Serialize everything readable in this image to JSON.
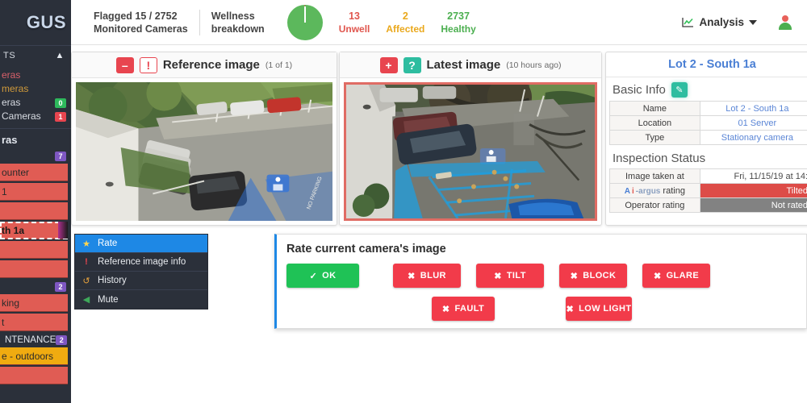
{
  "brand": {
    "logo_text": "GUS"
  },
  "header": {
    "flagged_line1": "Flagged 15 / 2752",
    "flagged_line2": "Monitored Cameras",
    "wellness_line1": "Wellness",
    "wellness_line2": "breakdown",
    "stats": [
      {
        "value": "13",
        "label": "Unwell",
        "color": "#e0564e"
      },
      {
        "value": "2",
        "label": "Affected",
        "color": "#eaa81c"
      },
      {
        "value": "2737",
        "label": "Healthy",
        "color": "#4caf50"
      }
    ],
    "analysis_label": "Analysis",
    "analysis_icon": "chart-line-icon",
    "user_icon": "user-avatar-icon"
  },
  "sidebar": {
    "section_header": "TS",
    "collapse_icon": "chevron-up-icon",
    "links": [
      {
        "label": "eras",
        "color": "#d8606a",
        "badge": null
      },
      {
        "label": "meras",
        "color": "#d09a3a",
        "badge": null
      },
      {
        "label": "eras",
        "color": "#d8dce3",
        "badge": "0",
        "badge_color": "#2eb85c"
      },
      {
        "label": "Cameras",
        "color": "#d8dce3",
        "badge": "1",
        "badge_color": "#e8454f"
      }
    ],
    "subhead": "ras",
    "groups": [
      {
        "badge": "7",
        "badge_color": "#7e57c2",
        "cameras": [
          {
            "label": "ounter",
            "state": "red",
            "selected": false
          },
          {
            "label": "1",
            "state": "red",
            "selected": false
          },
          {
            "label": "",
            "state": "red",
            "selected": false
          },
          {
            "label": "th 1a",
            "state": "red",
            "selected": true
          },
          {
            "label": "",
            "state": "red",
            "selected": false
          },
          {
            "label": "",
            "state": "red",
            "selected": false
          }
        ]
      },
      {
        "badge": "2",
        "badge_color": "#7e57c2",
        "cameras": [
          {
            "label": "king",
            "state": "red",
            "selected": false
          },
          {
            "label": "t",
            "state": "red",
            "selected": false
          }
        ]
      },
      {
        "label": "NTENANCE",
        "badge": "2",
        "badge_color": "#7e57c2",
        "cameras": [
          {
            "label": "e - outdoors",
            "state": "amber",
            "selected": false
          },
          {
            "label": "",
            "state": "red",
            "selected": false
          }
        ]
      }
    ]
  },
  "reference_panel": {
    "minus_icon": "minus-icon",
    "alert_icon": "exclamation-icon",
    "title": "Reference image",
    "subtitle": "(1 of 1)"
  },
  "latest_panel": {
    "plus_icon": "plus-icon",
    "question_icon": "question-icon",
    "title": "Latest image",
    "subtitle": "(10 hours ago)"
  },
  "info_panel": {
    "title": "Lot 2 - South 1a",
    "basic_info_label": "Basic Info",
    "edit_icon": "edit-pencil-icon",
    "basic_rows": [
      {
        "key": "Name",
        "value": "Lot 2 - South 1a"
      },
      {
        "key": "Location",
        "value": "01 Server"
      },
      {
        "key": "Type",
        "value": "Stationary camera"
      }
    ],
    "inspection_label": "Inspection Status",
    "inspection_rows": [
      {
        "key": "Image taken at",
        "value": "Fri, 11/15/19 at 14:",
        "style": "plain"
      },
      {
        "key": "rating",
        "key_logo": "AI-ARGUS",
        "value": "Tilted",
        "style": "bad"
      },
      {
        "key": "Operator rating",
        "value": "Not rated",
        "style": "none"
      }
    ]
  },
  "rate_menu": {
    "items": [
      {
        "label": "Rate",
        "icon": "star-icon",
        "active": true
      },
      {
        "label": "Reference image info",
        "icon": "exclamation-icon",
        "active": false
      },
      {
        "label": "History",
        "icon": "history-icon",
        "active": false
      },
      {
        "label": "Mute",
        "icon": "mute-icon",
        "active": false
      }
    ]
  },
  "rate_dialog": {
    "heading": "Rate current camera's image",
    "ok_button": {
      "label": "OK",
      "icon": "check-icon",
      "color": "#1fc256"
    },
    "reject_buttons_row1": [
      {
        "label": "BLUR",
        "icon": "x-icon"
      },
      {
        "label": "TILT",
        "icon": "x-icon"
      },
      {
        "label": "BLOCK",
        "icon": "x-icon"
      },
      {
        "label": "GLARE",
        "icon": "x-icon"
      }
    ],
    "reject_buttons_row2": [
      {
        "label": "FAULT",
        "icon": "x-icon"
      },
      {
        "label": "LOW LIGHT",
        "icon": "x-icon"
      }
    ],
    "reject_color": "#f23b4a"
  }
}
